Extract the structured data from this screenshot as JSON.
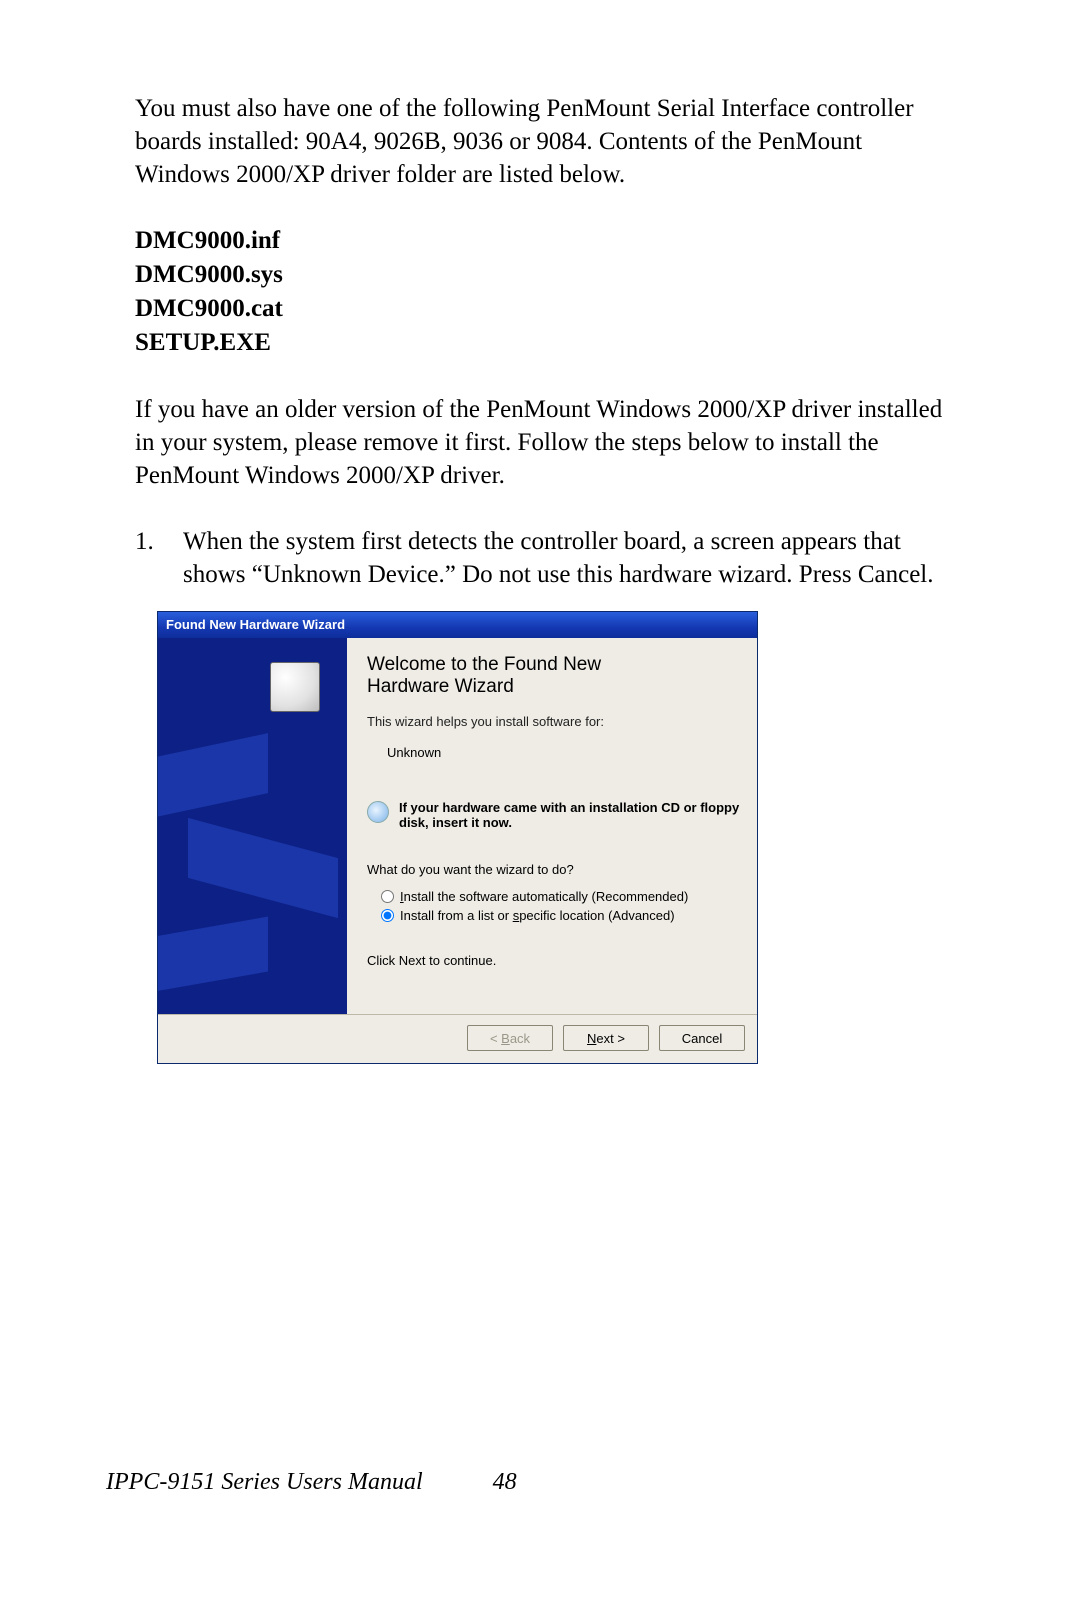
{
  "para1": "You must also have one of the following PenMount Serial Interface controller boards installed: 90A4, 9026B, 9036 or 9084. Contents of the PenMount Windows 2000/XP driver folder are listed below.",
  "files": {
    "f0": "DMC9000.inf",
    "f1": "DMC9000.sys",
    "f2": "DMC9000.cat",
    "f3": "SETUP.EXE"
  },
  "para2": "If you have an older version of the PenMount Windows 2000/XP driver installed in your system, please remove it first. Follow the steps below to install the PenMount Windows 2000/XP driver.",
  "step1_num": "1.",
  "step1": "When the system first detects the controller board, a screen appears that shows “Unknown Device.” Do not use this hardware wizard. Press Cancel.",
  "wizard": {
    "title": "Found New Hardware Wizard",
    "welcome1": "Welcome to the Found New",
    "welcome2": "Hardware Wizard",
    "help": "This wizard helps you install software for:",
    "device": "Unknown",
    "cd_hint": "If your hardware came with an installation CD or floppy disk, insert it now.",
    "question": "What do you want the wizard to do?",
    "radio1_pre": "I",
    "radio1_rest": "nstall the software automatically (Recommended)",
    "radio2": "Install from a list or ",
    "radio2_underline": "s",
    "radio2_rest": "pecific location (Advanced)",
    "click_next": "Click Next to continue.",
    "back_lt": "< ",
    "back_under": "B",
    "back_rest": "ack",
    "next_under": "N",
    "next_rest": "ext >",
    "cancel": "Cancel"
  },
  "footer": {
    "manual": "IPPC-9151 Series Users Manual",
    "page": "48"
  }
}
